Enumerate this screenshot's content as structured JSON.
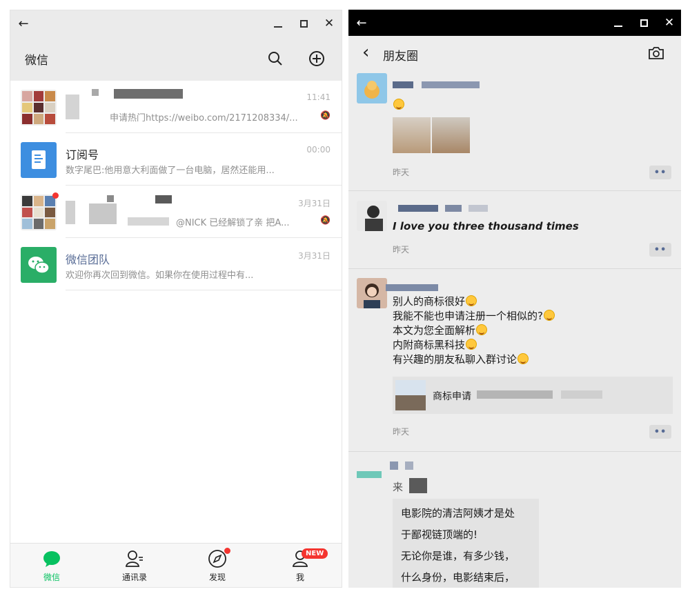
{
  "left_window": {
    "titlebar": {
      "back_icon": "←",
      "min_icon": "minimize-icon",
      "max_icon": "maximize-icon",
      "close_icon": "✕"
    },
    "appbar": {
      "title": "微信",
      "search_icon": "search-icon",
      "add_icon": "add-icon"
    },
    "chats": [
      {
        "name": "",
        "preview": "申请热门https://weibo.com/2171208334/...",
        "time": "11:41",
        "muted": true
      },
      {
        "name": "订阅号",
        "preview": "数字尾巴:他用意大利面做了一台电脑，居然还能用...",
        "time": "00:00",
        "muted": false
      },
      {
        "name": "",
        "preview": "@NICK 已经解锁了亲 把A...",
        "time": "3月31日",
        "muted": true
      },
      {
        "name": "微信团队",
        "preview": "欢迎你再次回到微信。如果你在使用过程中有...",
        "time": "3月31日",
        "muted": false
      }
    ],
    "tabbar": {
      "tabs": [
        {
          "label": "微信",
          "active": true
        },
        {
          "label": "通讯录",
          "active": false
        },
        {
          "label": "发现",
          "active": false
        },
        {
          "label": "我",
          "active": false
        }
      ],
      "new_badge": "NEW"
    },
    "colors": {
      "accent": "#07c160",
      "badge": "#f43530",
      "chat_link": "#576b95"
    }
  },
  "right_window": {
    "titlebar": {
      "back_icon": "←",
      "close_icon": "✕"
    },
    "appbar": {
      "back_icon": "‹",
      "title": "朋友圈",
      "camera_icon": "camera-icon"
    },
    "posts": [
      {
        "text": "",
        "time": "昨天"
      },
      {
        "text": "I love you three thousand times",
        "time": "昨天"
      },
      {
        "lines": [
          "别人的商标很好",
          "我能不能也申请注册一个相似的?",
          "本文为您全面解析",
          "内附商标黑科技",
          "有兴趣的朋友私聊入群讨论"
        ],
        "link_title": "商标申请",
        "time": "昨天"
      },
      {
        "prefix": "来",
        "share_lines": [
          "电影院的清洁阿姨才是处",
          "于鄙视链顶端的!",
          "无论你是谁，有多少钱，",
          "什么身份，电影结束后，"
        ]
      }
    ],
    "more_icon": "••"
  }
}
